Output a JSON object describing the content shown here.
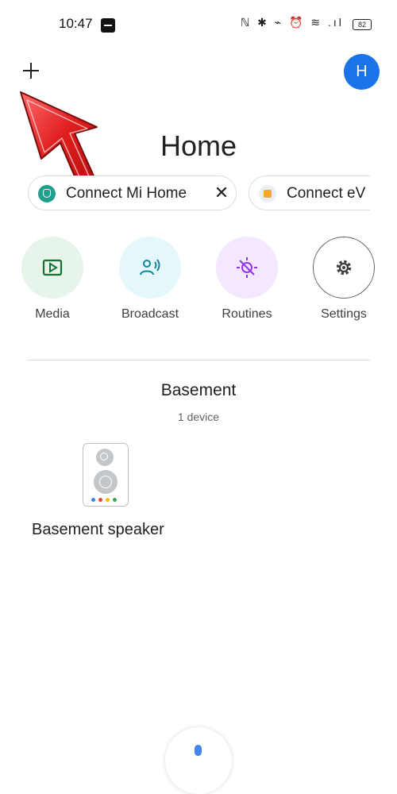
{
  "status_bar": {
    "time": "10:47",
    "icons_text": "ℕ ✱ ⌁ ⏰ ≋ .ıl",
    "battery": "82"
  },
  "header": {
    "avatar_letter": "H",
    "title": "Home"
  },
  "chips": [
    {
      "label": "Connect Mi Home",
      "close": "✕"
    },
    {
      "label": "Connect eV"
    }
  ],
  "actions": [
    {
      "label": "Media"
    },
    {
      "label": "Broadcast"
    },
    {
      "label": "Routines"
    },
    {
      "label": "Settings"
    }
  ],
  "room": {
    "name": "Basement",
    "count": "1 device",
    "devices": [
      {
        "name": "Basement speaker"
      }
    ]
  },
  "colors": {
    "avatar": "#1a73e8",
    "annotation_arrow": "#e01e1e",
    "media_accent": "#137333",
    "broadcast_accent": "#12859c",
    "routines_accent": "#9334e6"
  }
}
